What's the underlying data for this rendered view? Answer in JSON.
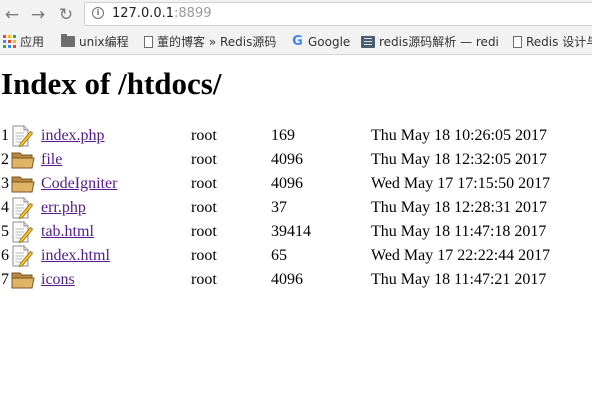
{
  "browser": {
    "url_host": "127.0.0.1",
    "url_port": ":8899",
    "nav": {
      "back_glyph": "←",
      "forward_glyph": "→",
      "reload_glyph": "↻"
    },
    "bookmarks": [
      {
        "label": "应用",
        "icon": "apps-icon"
      },
      {
        "label": "unix编程",
        "icon": "folder-icon"
      },
      {
        "label": "董的博客 » Redis源码",
        "icon": "page-icon"
      },
      {
        "label": "Google",
        "icon": "google-icon"
      },
      {
        "label": "redis源码解析 — redi",
        "icon": "book-icon"
      },
      {
        "label": "Redis 设计与",
        "icon": "page-icon"
      }
    ]
  },
  "page": {
    "title": "Index of /htdocs/",
    "entries": [
      {
        "index": "1",
        "type": "file",
        "name": "index.php",
        "owner": "root",
        "size": "169",
        "date": "Thu May 18 10:26:05 2017"
      },
      {
        "index": "2",
        "type": "folder",
        "name": "file",
        "owner": "root",
        "size": "4096",
        "date": "Thu May 18 12:32:05 2017"
      },
      {
        "index": "3",
        "type": "folder",
        "name": "CodeIgniter",
        "owner": "root",
        "size": "4096",
        "date": "Wed May 17 17:15:50 2017"
      },
      {
        "index": "4",
        "type": "file",
        "name": "err.php",
        "owner": "root",
        "size": "37",
        "date": "Thu May 18 12:28:31 2017"
      },
      {
        "index": "5",
        "type": "file",
        "name": "tab.html",
        "owner": "root",
        "size": "39414",
        "date": "Thu May 18 11:47:18 2017"
      },
      {
        "index": "6",
        "type": "file",
        "name": "index.html",
        "owner": "root",
        "size": "65",
        "date": "Wed May 17 22:22:44 2017"
      },
      {
        "index": "7",
        "type": "folder",
        "name": "icons",
        "owner": "root",
        "size": "4096",
        "date": "Thu May 18 11:47:21 2017"
      }
    ]
  },
  "colors": {
    "link_visited": "#551a8b",
    "chrome_bg": "#f2f2f2"
  }
}
